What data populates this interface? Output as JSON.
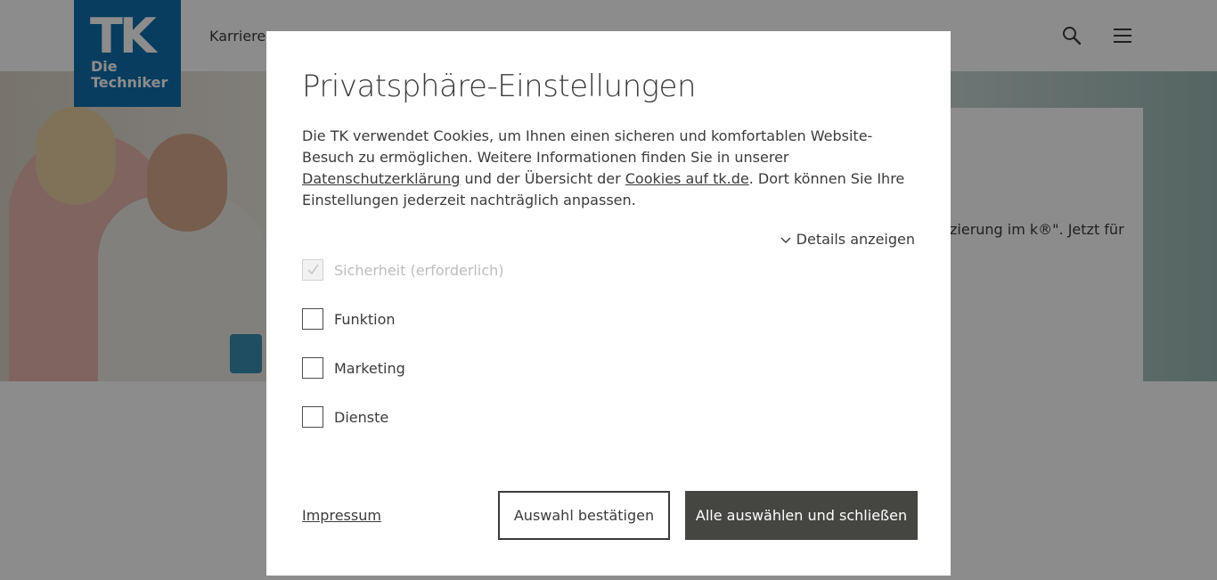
{
  "header": {
    "logo": {
      "mark": "TK",
      "line1": "Die",
      "line2": "Techniker",
      "color": "#0f6fae"
    },
    "nav_career": "Karriere",
    "search_icon": "search-icon",
    "menu_icon": "hamburger-menu-icon"
  },
  "teaser": {
    "text": "zierung im k®\". Jetzt für"
  },
  "modal": {
    "title": "Privatsphäre-Einstellungen",
    "intro": {
      "part1": "Die TK verwendet Cookies, um Ihnen einen sicheren und komfortablen Website-Besuch zu ermöglichen. Weitere Informationen finden Sie in unserer ",
      "link1": "Datenschutzerklärung",
      "part2": " und der Übersicht der ",
      "link2": "Cookies auf tk.de",
      "part3": ". Dort können Sie Ihre Einstellungen jederzeit nachträglich anpassen."
    },
    "details_toggle": "Details anzeigen",
    "options": [
      {
        "label": "Sicherheit (erforderlich)",
        "checked": true,
        "disabled": true
      },
      {
        "label": "Funktion",
        "checked": false,
        "disabled": false
      },
      {
        "label": "Marketing",
        "checked": false,
        "disabled": false
      },
      {
        "label": "Dienste",
        "checked": false,
        "disabled": false
      }
    ],
    "impressum": "Impressum",
    "confirm_button": "Auswahl bestätigen",
    "accept_all_button": "Alle auswählen und schließen",
    "accept_all_color": "#454542"
  }
}
